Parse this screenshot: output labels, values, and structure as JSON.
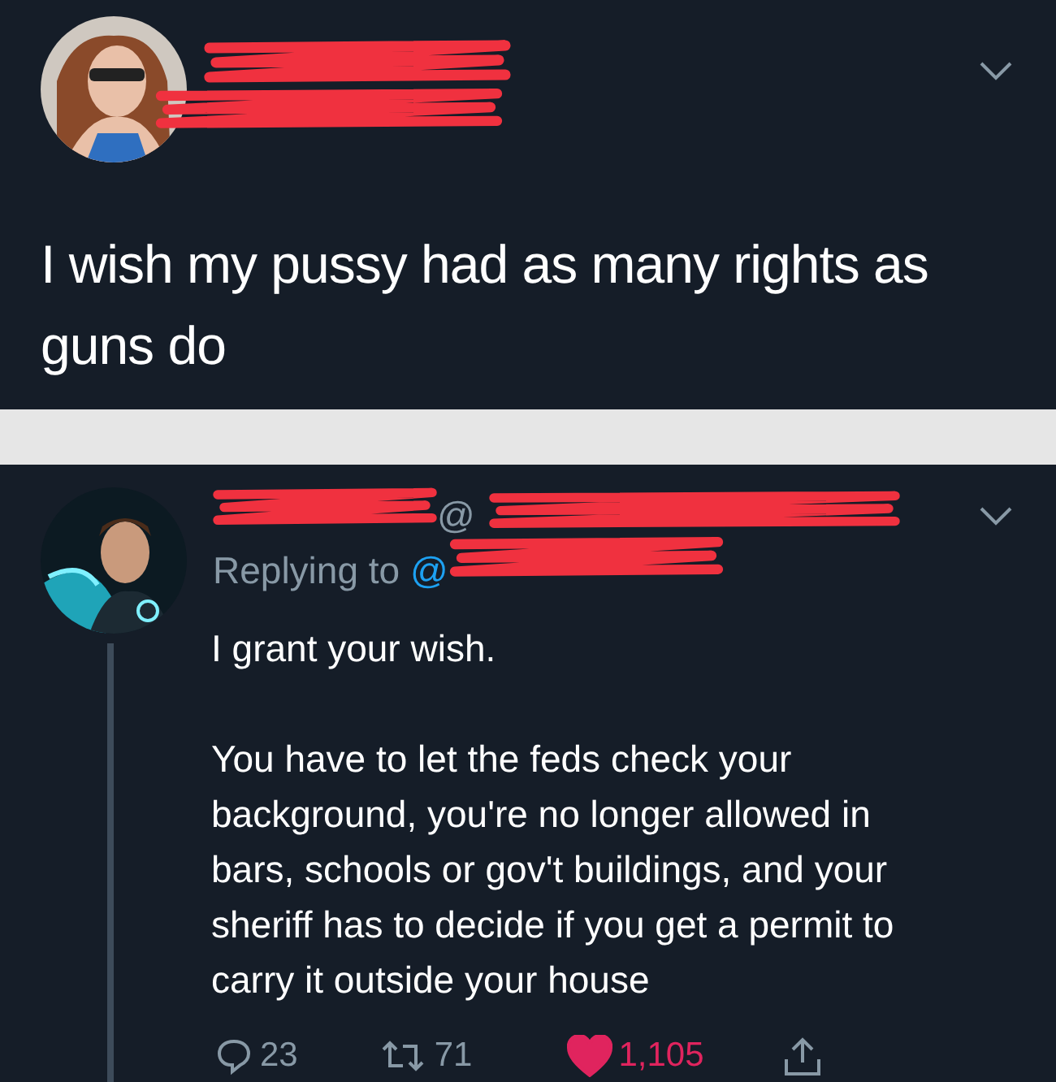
{
  "tweets": [
    {
      "body": [
        "I wish my pussy had as many rights as guns do"
      ]
    },
    {
      "handle_fragment": "@",
      "replying": {
        "label": "Replying to",
        "mention": "@"
      },
      "body": [
        "I grant your wish.",
        "You have to let the feds check your background, you're no longer allowed in bars, schools or gov't buildings, and your sheriff  has to decide if you get a permit to carry it outside your house"
      ],
      "actions": {
        "replies": "23",
        "retweets": "71",
        "likes": "1,105",
        "liked": true
      }
    }
  ]
}
